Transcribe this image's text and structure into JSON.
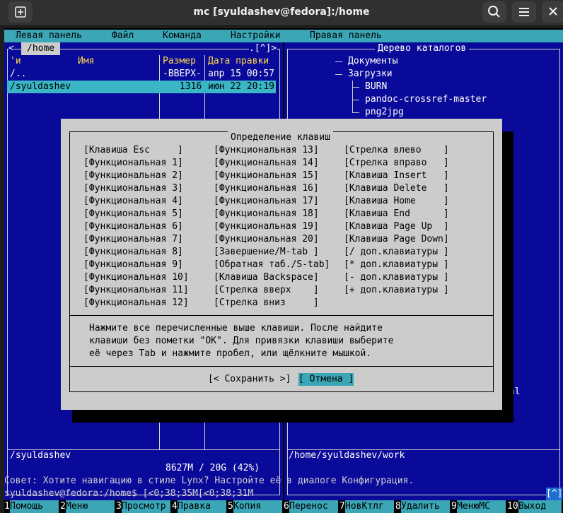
{
  "window": {
    "title": "mc [syuldashev@fedora]:/home",
    "new_tab_icon": "⊞",
    "search_icon": "search-icon",
    "menu_icon": "hamburger-icon"
  },
  "menubar": [
    "Левая панель",
    "Файл",
    "Команда",
    "Настройки",
    "Правая панель"
  ],
  "left_panel": {
    "header_left": "<",
    "path": "/home",
    "header_right": ".[^]>",
    "col_sort": "'и",
    "col_name": "Имя",
    "col_size": "Размер",
    "col_date": "Дата правки",
    "rows": [
      {
        "name": "/..",
        "size": "-ВВЕРХ-",
        "date": "апр 15 00:57"
      },
      {
        "name": "/syuldashev",
        "size": "1316",
        "date": "июн 22 20:19"
      }
    ],
    "footer_path": "/syuldashev",
    "disk": "8627M / 20G (42%)"
  },
  "right_panel": {
    "title": "Дерево каталогов",
    "tree": [
      "Документы",
      "Загрузки",
      "BURN",
      "pandoc-crossref-master",
      "png2jpg"
    ],
    "partial_1": "ы",
    "partial_2": "nal",
    "footer_path": "/home/syuldashev/work"
  },
  "dialog": {
    "title": "Определение клавиш",
    "col1": [
      "[Клавиша Esc     ]",
      "[Функциональная 1]",
      "[Функциональная 2]",
      "[Функциональная 3]",
      "[Функциональная 4]",
      "[Функциональная 5]",
      "[Функциональная 6]",
      "[Функциональная 7]",
      "[Функциональная 8]",
      "[Функциональная 9]",
      "[Функциональная 10]",
      "[Функциональная 11]",
      "[Функциональная 12]"
    ],
    "col2": [
      "[Функциональная 13]",
      "[Функциональная 14]",
      "[Функциональная 15]",
      "[Функциональная 16]",
      "[Функциональная 17]",
      "[Функциональная 18]",
      "[Функциональная 19]",
      "[Функциональная 20]",
      "[Завершение/M-tab ]",
      "[Обратная таб./S-tab]",
      "[Клавиша Backspace]",
      "[Стрелка вверх    ]",
      "[Стрелка вниз     ]"
    ],
    "col3": [
      "[Стрелка влево    ]",
      "[Стрелка вправо   ]",
      "[Клавиша Insert   ]",
      "[Клавиша Delete   ]",
      "[Клавиша Home     ]",
      "[Клавиша End      ]",
      "[Клавиша Page Up  ]",
      "[Клавиша Page Down]",
      "[/ доп.клавиатуры ]",
      "[* доп.клавиатуры ]",
      "[- доп.клавиатуры ]",
      "[+ доп.клавиатуры ]"
    ],
    "help": [
      "Нажмите все перечисленные выше клавиши. После найдите",
      "клавиши без пометки \"OK\". Для привязки клавиши выберите",
      "её через Tab и нажмите пробел, или щёлкните мышкой."
    ],
    "save_button": "[< Сохранить >]",
    "cancel_button": "[ Отмена ]"
  },
  "hint": "Совет: Хотите навигацию в стиле Lynx? Настройте её в диалоге Конфигурация.",
  "prompt": "syuldashev@fedora:/home$ [<0;38;35M[<0;38;31M",
  "prompt_indicator": "[^]",
  "fkeys": [
    {
      "num": "1",
      "label": "Помощь"
    },
    {
      "num": "2",
      "label": "Меню"
    },
    {
      "num": "3",
      "label": "Просмотр"
    },
    {
      "num": "4",
      "label": "Правка"
    },
    {
      "num": "5",
      "label": "Копия"
    },
    {
      "num": "6",
      "label": "Перенос"
    },
    {
      "num": "7",
      "label": "НовКтлг"
    },
    {
      "num": "8",
      "label": "Удалить"
    },
    {
      "num": "9",
      "label": "МенюМС"
    },
    {
      "num": "10",
      "label": "Выход"
    }
  ],
  "colors": {
    "panel": "#0a0a9a",
    "menubar": "#3aa6b6",
    "dialog": "#cccccc",
    "selection": "#3ab6c6"
  }
}
